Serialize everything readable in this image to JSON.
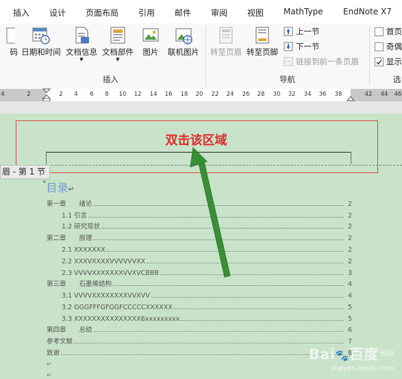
{
  "tabs": [
    "插入",
    "设计",
    "页面布局",
    "引用",
    "邮件",
    "审阅",
    "视图",
    "MathType",
    "EndNote X7"
  ],
  "ribbon": {
    "partial_left_label": "码",
    "date_time": "日期和时间",
    "doc_info": "文档信息",
    "doc_parts": "文档部件",
    "picture": "图片",
    "online_picture": "联机图片",
    "insert_group": "插入",
    "goto_header": "转至页眉",
    "goto_footer": "转至页脚",
    "prev_section": "上一节",
    "next_section": "下一节",
    "link_previous": "链接到前一条页眉",
    "nav_group": "导航",
    "opt_first_page": "首页",
    "opt_odd_even": "奇偶",
    "opt_show": "显示",
    "options_group_partial": "选"
  },
  "ruler": {
    "numbers": [
      "4",
      "2",
      "2",
      "4",
      "6",
      "8",
      "10",
      "12",
      "14",
      "16",
      "18",
      "20",
      "22",
      "24",
      "26",
      "28",
      "30",
      "32",
      "34",
      "36",
      "38",
      "42",
      "44",
      "46"
    ]
  },
  "document": {
    "annotation": "双击该区域",
    "header_label": "眉 - 第 1 节",
    "toc_title": "目录",
    "toc": [
      {
        "text": "第一章　　绪论",
        "page": "2",
        "indent": 0
      },
      {
        "text": "1.1 引言",
        "page": "2",
        "indent": 1
      },
      {
        "text": "1.2 研究现状",
        "page": "2",
        "indent": 1
      },
      {
        "text": "第二章　　原理",
        "page": "2",
        "indent": 0
      },
      {
        "text": "2.1 XXXXXXX",
        "page": "2",
        "indent": 1
      },
      {
        "text": "2.2 XXXVXXXXVVVVVVXX",
        "page": "2",
        "indent": 1
      },
      {
        "text": "2.3 VVVVXXXXXXXVVXVCBBB",
        "page": "3",
        "indent": 1
      },
      {
        "text": "第三章　　石墨烯结构",
        "page": "4",
        "indent": 0
      },
      {
        "text": "3.1 VVVVXXXXXXXXVVXVV",
        "page": "4",
        "indent": 1
      },
      {
        "text": "3.2 GGGFFFGFGGFCCCCCXXXXXX",
        "page": "5",
        "indent": 1
      },
      {
        "text": "3.3 XXXXXXXXXXXXXXX6xxxxxxxxx",
        "page": "5",
        "indent": 1
      },
      {
        "text": "第四章　　总结",
        "page": "6",
        "indent": 0
      },
      {
        "text": "参考文献",
        "page": "7",
        "indent": 0
      },
      {
        "text": "致谢",
        "page": "8",
        "indent": 0
      }
    ]
  },
  "watermark": {
    "brand": "Bai",
    "brand2": "百度",
    "suffix": "经验",
    "url": "jingyan.baidu.com"
  },
  "colors": {
    "accent": "#e02a2a",
    "arrow": "#3a8f36",
    "page": "#c8e3c9",
    "toc_title": "#6f9bd4"
  }
}
